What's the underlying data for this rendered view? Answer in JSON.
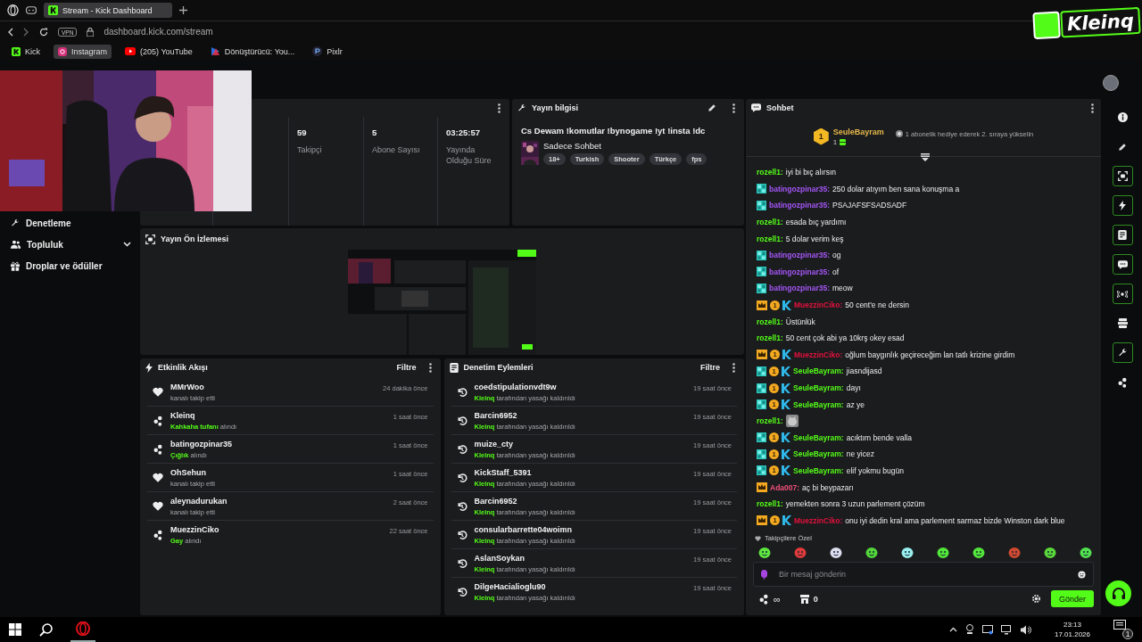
{
  "browser": {
    "tab_title": "Stream - Kick Dashboard",
    "vpn": "VPN",
    "address": "dashboard.kick.com/stream",
    "bookmarks": [
      {
        "label": "Kick",
        "kind": "kick",
        "selected": false
      },
      {
        "label": "Instagram",
        "kind": "instagram",
        "selected": true
      },
      {
        "label": "(205) YouTube",
        "kind": "youtube",
        "selected": false
      },
      {
        "label": "Dönüştürücü: You...",
        "kind": "converter",
        "selected": false
      },
      {
        "label": "Pixlr",
        "kind": "pixlr",
        "selected": false
      }
    ]
  },
  "overlay_logo": "Kleinq",
  "sidebar": {
    "items": [
      {
        "label": "Denetleme",
        "kind": "moderation"
      },
      {
        "label": "Topluluk",
        "kind": "community",
        "expanded": false
      },
      {
        "label": "Droplar ve ödüller",
        "kind": "drops"
      }
    ]
  },
  "stats": {
    "items": [
      {
        "value": "59",
        "label": "Takipçi"
      },
      {
        "value": "5",
        "label": "Abone Sayısı"
      },
      {
        "value": "03:25:57",
        "label": "Yayında Olduğu Süre"
      }
    ]
  },
  "stream_info": {
    "title": "Yayın bilgisi",
    "stream_title": "Cs Dewam !komutlar !bynogame !yt !insta !dc",
    "category": "Sadece Sohbet",
    "tags": [
      "18+",
      "Turkish",
      "Shooter",
      "Türkçe",
      "fps"
    ]
  },
  "preview": {
    "title": "Yayın Ön İzlemesi"
  },
  "activity": {
    "title": "Etkinlik Akışı",
    "filter": "Filtre",
    "items": [
      {
        "kind": "follow",
        "user": "MMrWoo",
        "time": "24 dakika önce",
        "detail": "kanalı takip etti"
      },
      {
        "kind": "reward",
        "user": "Kleinq",
        "time": "1 saat önce",
        "detail": "**Kahkaha tufanı** alındı"
      },
      {
        "kind": "reward",
        "user": "batingozpinar35",
        "time": "1 saat önce",
        "detail": "**Çığlık** alındı"
      },
      {
        "kind": "follow",
        "user": "OhSehun",
        "time": "1 saat önce",
        "detail": "kanalı takip etti"
      },
      {
        "kind": "follow",
        "user": "aleynadurukan",
        "time": "2 saat önce",
        "detail": "kanalı takip etti"
      },
      {
        "kind": "reward",
        "user": "MuezzinCiko",
        "time": "22 saat önce",
        "detail": "**Gay** alındı"
      }
    ]
  },
  "moderation": {
    "title": "Denetim Eylemleri",
    "filter": "Filtre",
    "items": [
      {
        "kind": "unban",
        "user": "coedstipulationvdt9w",
        "time": "19 saat önce",
        "detail": "**Kleinq** tarafından yasağı kaldırıldı"
      },
      {
        "kind": "unban",
        "user": "Barcin6952",
        "time": "19 saat önce",
        "detail": "**Kleinq** tarafından yasağı kaldırıldı"
      },
      {
        "kind": "unban",
        "user": "muize_cty",
        "time": "19 saat önce",
        "detail": "**Kleinq** tarafından yasağı kaldırıldı"
      },
      {
        "kind": "unban",
        "user": "KickStaff_5391",
        "time": "19 saat önce",
        "detail": "**Kleinq** tarafından yasağı kaldırıldı"
      },
      {
        "kind": "unban",
        "user": "Barcin6952",
        "time": "19 saat önce",
        "detail": "**Kleinq** tarafından yasağı kaldırıldı"
      },
      {
        "kind": "unban",
        "user": "consularbarrette04woimn",
        "time": "19 saat önce",
        "detail": "**Kleinq** tarafından yasağı kaldırıldı"
      },
      {
        "kind": "unban",
        "user": "AslanSoykan",
        "time": "19 saat önce",
        "detail": "**Kleinq** tarafından yasağı kaldırıldı"
      },
      {
        "kind": "unban",
        "user": "DilgeHacialioglu90",
        "time": "19 saat önce",
        "detail": "**Kleinq** tarafından yasağı kaldırıldı"
      }
    ]
  },
  "chat": {
    "title": "Sohbet",
    "leader": {
      "rank": "1",
      "name": "SeuleBayram",
      "count": "1",
      "hint": "1 abonelik hediye ederek 2. sıraya yükselin"
    },
    "messages": [
      {
        "kind": "text",
        "user": "rozell1:",
        "color": "#53fc18",
        "text": "iyi bi bıç alırsın"
      },
      {
        "kind": "text",
        "badges": [
          {
            "kind": "subscriber"
          }
        ],
        "user": "batingozpinar35:",
        "color": "#a356f5",
        "text": "250 dolar atıyım ben sana konuşma a"
      },
      {
        "kind": "text",
        "badges": [
          {
            "kind": "subscriber"
          }
        ],
        "user": "batingozpinar35:",
        "color": "#a356f5",
        "text": "PSAJAFSFSADSADF"
      },
      {
        "kind": "text",
        "user": "rozell1:",
        "color": "#53fc18",
        "text": "esada bıç yardımı"
      },
      {
        "kind": "text",
        "user": "rozell1:",
        "color": "#53fc18",
        "text": "5 dolar verim keş"
      },
      {
        "kind": "text",
        "badges": [
          {
            "kind": "subscriber"
          }
        ],
        "user": "batingozpinar35:",
        "color": "#a356f5",
        "text": "og"
      },
      {
        "kind": "text",
        "badges": [
          {
            "kind": "subscriber"
          }
        ],
        "user": "batingozpinar35:",
        "color": "#a356f5",
        "text": "of"
      },
      {
        "kind": "text",
        "badges": [
          {
            "kind": "subscriber"
          }
        ],
        "user": "batingozpinar35:",
        "color": "#a356f5",
        "text": "meow"
      },
      {
        "kind": "text",
        "badges": [
          {
            "kind": "crown"
          },
          {
            "kind": "gifter",
            "text": "1"
          },
          {
            "kind": "kick"
          }
        ],
        "user": "MuezzinCiko:",
        "color": "#e0123c",
        "text": "50 cent'e ne dersin"
      },
      {
        "kind": "text",
        "user": "rozell1:",
        "color": "#53fc18",
        "text": "Üstünlük"
      },
      {
        "kind": "text",
        "user": "rozell1:",
        "color": "#53fc18",
        "text": "50 cent çok abi ya 10krş okey esad"
      },
      {
        "kind": "text",
        "badges": [
          {
            "kind": "crown"
          },
          {
            "kind": "gifter",
            "text": "1"
          },
          {
            "kind": "kick"
          }
        ],
        "user": "MuezzinCiko:",
        "color": "#e0123c",
        "text": "oğlum baygınlık geçireceğim lan tatlı krizine girdim"
      },
      {
        "kind": "text",
        "badges": [
          {
            "kind": "subscriber"
          },
          {
            "kind": "gifter",
            "text": "1"
          },
          {
            "kind": "kick"
          }
        ],
        "user": "SeuleBayram:",
        "color": "#53fc18",
        "text": "jiasndijasd"
      },
      {
        "kind": "text",
        "badges": [
          {
            "kind": "subscriber"
          },
          {
            "kind": "gifter",
            "text": "1"
          },
          {
            "kind": "kick"
          }
        ],
        "user": "SeuleBayram:",
        "color": "#53fc18",
        "text": "dayı"
      },
      {
        "kind": "text",
        "badges": [
          {
            "kind": "subscriber"
          },
          {
            "kind": "gifter",
            "text": "1"
          },
          {
            "kind": "kick"
          }
        ],
        "user": "SeuleBayram:",
        "color": "#53fc18",
        "text": "az ye"
      },
      {
        "kind": "emote",
        "user": "rozell1:",
        "color": "#53fc18"
      },
      {
        "kind": "text",
        "badges": [
          {
            "kind": "subscriber"
          },
          {
            "kind": "gifter",
            "text": "1"
          },
          {
            "kind": "kick"
          }
        ],
        "user": "SeuleBayram:",
        "color": "#53fc18",
        "text": "acıktım bende valla"
      },
      {
        "kind": "text",
        "badges": [
          {
            "kind": "subscriber"
          },
          {
            "kind": "gifter",
            "text": "1"
          },
          {
            "kind": "kick"
          }
        ],
        "user": "SeuleBayram:",
        "color": "#53fc18",
        "text": "ne yicez"
      },
      {
        "kind": "text",
        "badges": [
          {
            "kind": "subscriber"
          },
          {
            "kind": "gifter",
            "text": "1"
          },
          {
            "kind": "kick"
          }
        ],
        "user": "SeuleBayram:",
        "color": "#53fc18",
        "text": "elif yokmu bugün"
      },
      {
        "kind": "text",
        "badges": [
          {
            "kind": "crown"
          }
        ],
        "user": "Ada007:",
        "color": "#f0507a",
        "text": "aç bi beypazarı"
      },
      {
        "kind": "text",
        "user": "rozell1:",
        "color": "#53fc18",
        "text": "yemekten sonra 3 uzun parlement çözüm"
      },
      {
        "kind": "text",
        "badges": [
          {
            "kind": "crown"
          },
          {
            "kind": "gifter",
            "text": "1"
          },
          {
            "kind": "kick"
          }
        ],
        "user": "MuezzinCiko:",
        "color": "#e0123c",
        "text": "onu iyi dedin kral ama parlement sarmaz bizde Winston dark blue"
      }
    ],
    "emotes_label": "Takipçilere Özel",
    "emotes": [
      {
        "kind": "halo"
      },
      {
        "kind": "angry"
      },
      {
        "kind": "headphones"
      },
      {
        "kind": "smile"
      },
      {
        "kind": "spin"
      },
      {
        "kind": "grin"
      },
      {
        "kind": "grin"
      },
      {
        "kind": "hat"
      },
      {
        "kind": "wink"
      },
      {
        "kind": "tongue"
      }
    ],
    "input": {
      "placeholder": "Bir mesaj gönderin"
    },
    "drops": "∞",
    "store": "0",
    "send": "Gönder"
  },
  "rail": [
    {
      "kind": "info",
      "active": false
    },
    {
      "kind": "edit",
      "active": false
    },
    {
      "kind": "preview",
      "active": true
    },
    {
      "kind": "activity",
      "active": true
    },
    {
      "kind": "moderation",
      "active": true
    },
    {
      "kind": "chat",
      "active": true
    },
    {
      "kind": "broadcast",
      "active": true
    },
    {
      "kind": "layers",
      "active": false
    },
    {
      "kind": "tools",
      "active": true
    },
    {
      "kind": "drops",
      "active": false
    }
  ],
  "taskbar": {
    "time": "23:13",
    "date": "17.01.2026",
    "notifications": "1"
  }
}
